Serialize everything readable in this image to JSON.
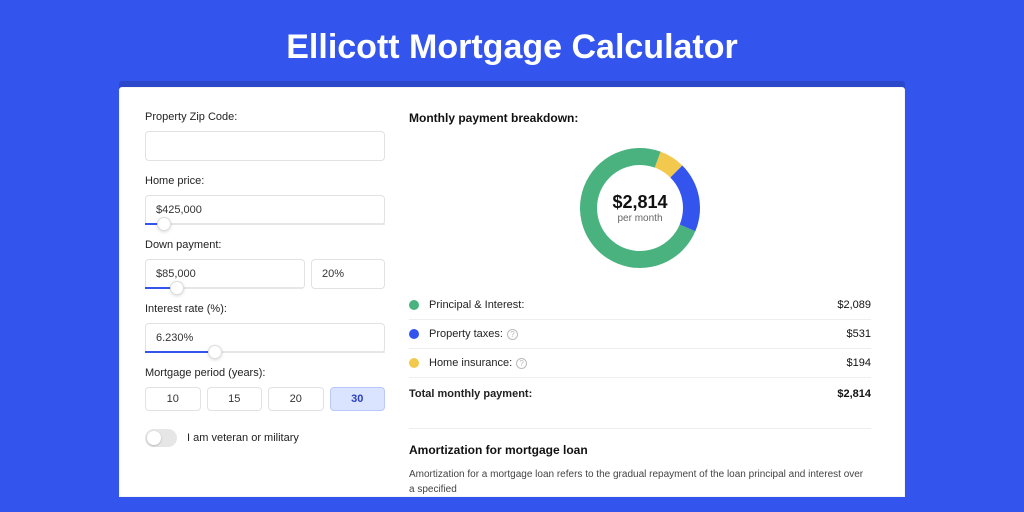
{
  "title": "Ellicott Mortgage Calculator",
  "form": {
    "zip_label": "Property Zip Code:",
    "zip_value": "",
    "home_price_label": "Home price:",
    "home_price_value": "$425,000",
    "home_price_slider_pct": 8,
    "down_payment_label": "Down payment:",
    "down_payment_value": "$85,000",
    "down_payment_pct": "20%",
    "down_payment_slider_pct": 20,
    "interest_label": "Interest rate (%):",
    "interest_value": "6.230%",
    "interest_slider_pct": 29,
    "period_label": "Mortgage period (years):",
    "periods": [
      "10",
      "15",
      "20",
      "30"
    ],
    "period_active_index": 3,
    "veteran_label": "I am veteran or military"
  },
  "breakdown": {
    "title": "Monthly payment breakdown:",
    "total_label": "Total monthly payment:",
    "total_value": "$2,814",
    "per_month": "per month",
    "items": [
      {
        "label": "Principal & Interest:",
        "value": "$2,089",
        "has_info": false
      },
      {
        "label": "Property taxes:",
        "value": "$531",
        "has_info": true
      },
      {
        "label": "Home insurance:",
        "value": "$194",
        "has_info": true
      }
    ]
  },
  "chart_data": {
    "type": "pie",
    "title": "Monthly payment breakdown",
    "series": [
      {
        "name": "Principal & Interest",
        "value": 2089,
        "color": "#49b27e"
      },
      {
        "name": "Property taxes",
        "value": 531,
        "color": "#3355ee"
      },
      {
        "name": "Home insurance",
        "value": 194,
        "color": "#f2c94c"
      }
    ],
    "total": 2814,
    "center_label": "$2,814",
    "center_sub": "per month"
  },
  "amortization": {
    "title": "Amortization for mortgage loan",
    "text": "Amortization for a mortgage loan refers to the gradual repayment of the loan principal and interest over a specified"
  }
}
